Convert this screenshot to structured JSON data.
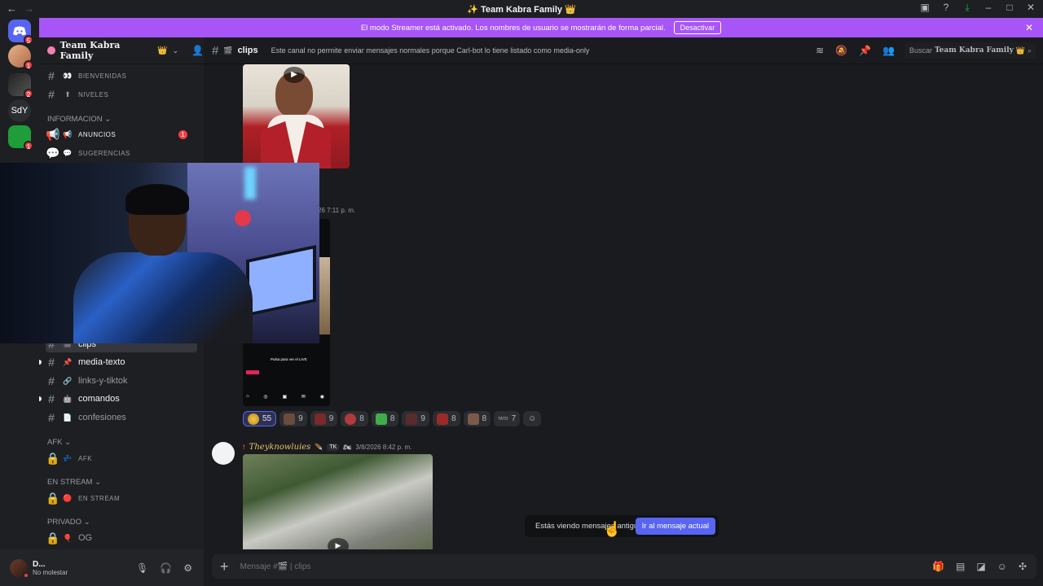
{
  "window": {
    "title": "Team Kabra Family",
    "title_emoji_left": "✨",
    "title_emoji_right": "👑",
    "back": "←",
    "forward": "→"
  },
  "guilds": [
    {
      "kind": "discord-home",
      "badge": "5"
    },
    {
      "kind": "avatar",
      "badge": "1"
    },
    {
      "kind": "server",
      "badge": "2"
    },
    {
      "kind": "text",
      "text": "SdY"
    },
    {
      "kind": "server",
      "badge": "1"
    }
  ],
  "streamer_banner": {
    "text": "El modo Streamer está activado. Los nombres de usuario se mostrarán de forma parcial.",
    "button": "Desactivar",
    "close": "✕"
  },
  "server": {
    "name": "Team Kabra Family",
    "crown": "👑"
  },
  "channels": {
    "top": [
      {
        "name": "BIENVENIDAS",
        "emoji": "👀"
      },
      {
        "name": "NIVELES",
        "emoji": "⬆"
      }
    ],
    "categories": {
      "informacion": "INFORMACION",
      "afk": "AFK",
      "en_stream": "EN STREAM",
      "privado": "PRIVADO"
    },
    "info": [
      {
        "name": "ANUNCIOS",
        "emoji": "📢",
        "badge": "1"
      },
      {
        "name": "SUGERENCIAS",
        "emoji": "💬"
      }
    ],
    "lower": [
      {
        "name": "clips",
        "emoji": "🎬"
      },
      {
        "name": "media-texto",
        "emoji": "📌"
      },
      {
        "name": "links-y-tiktok",
        "emoji": "🔗"
      },
      {
        "name": "comandos",
        "emoji": "🤖"
      },
      {
        "name": "confesiones",
        "emoji": "📄"
      }
    ],
    "afk": [
      {
        "name": "AFK",
        "emoji": "💤"
      }
    ],
    "stream": [
      {
        "name": "EN STREAM",
        "emoji": "🔴"
      }
    ],
    "privado": [
      {
        "name": "OG",
        "emoji": "🎈"
      }
    ]
  },
  "user": {
    "name": "D...",
    "status": "No molestar"
  },
  "topbar": {
    "channel": "clips",
    "channel_emoji": "🎬",
    "topic": "Este canal no permite enviar mensajes normales porque Carl-bot lo tiene listado como media-only",
    "search_prefix": "Buscar",
    "search_server": "Team Kabra Family",
    "search_crown": "👑"
  },
  "messages": {
    "timestamp_partial": "26 7:11 p. m.",
    "reactions": [
      {
        "count": "55",
        "me": true
      },
      {
        "count": "9"
      },
      {
        "count": "9"
      },
      {
        "count": "8"
      },
      {
        "count": "8"
      },
      {
        "count": "9"
      },
      {
        "count": "8"
      },
      {
        "count": "8"
      },
      {
        "count": "7",
        "label": "TATO"
      }
    ],
    "tiktok_overlay": "Pulsa para ver el LIVE",
    "second": {
      "bang": "!",
      "author": "Theyknowluies",
      "tag": "TK",
      "time": "3/8/2026 8:42 p. m."
    }
  },
  "jump_bar": {
    "text": "Estás viendo mensajes antiguos",
    "button": "Ir al mensaje actual"
  },
  "composer": {
    "placeholder": "Mensaje #🎬 | clips"
  },
  "colors": {
    "streamer_banner": "#a855f7",
    "accent": "#5865f2",
    "badge": "#f23f43"
  }
}
